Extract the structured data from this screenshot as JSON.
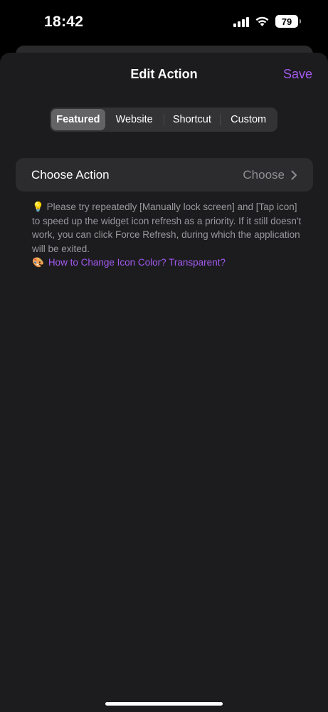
{
  "status_bar": {
    "time": "18:42",
    "battery_level": "79",
    "icons": [
      "cellular-signal-icon",
      "wifi-icon",
      "battery-icon"
    ]
  },
  "nav": {
    "title": "Edit Action",
    "save_label": "Save"
  },
  "segments": [
    {
      "label": "Featured",
      "selected": true
    },
    {
      "label": "Website",
      "selected": false
    },
    {
      "label": "Shortcut",
      "selected": false
    },
    {
      "label": "Custom",
      "selected": false
    }
  ],
  "action_row": {
    "label": "Choose Action",
    "value": "Choose"
  },
  "footer": {
    "tip_icon": "💡",
    "tip_text": "Please try repeatedly [Manually lock screen] and [Tap icon] to speed up the widget icon refresh as a priority. If it still doesn't work, you can click Force Refresh, during which the application will be exited.",
    "link_icon": "🎨",
    "link_text": "How to Change Icon Color? Transparent?"
  },
  "colors": {
    "accent": "#a259f0",
    "sheet_background": "#1c1c1e",
    "card_background": "#2c2c2e",
    "secondary_text": "#98989d"
  }
}
